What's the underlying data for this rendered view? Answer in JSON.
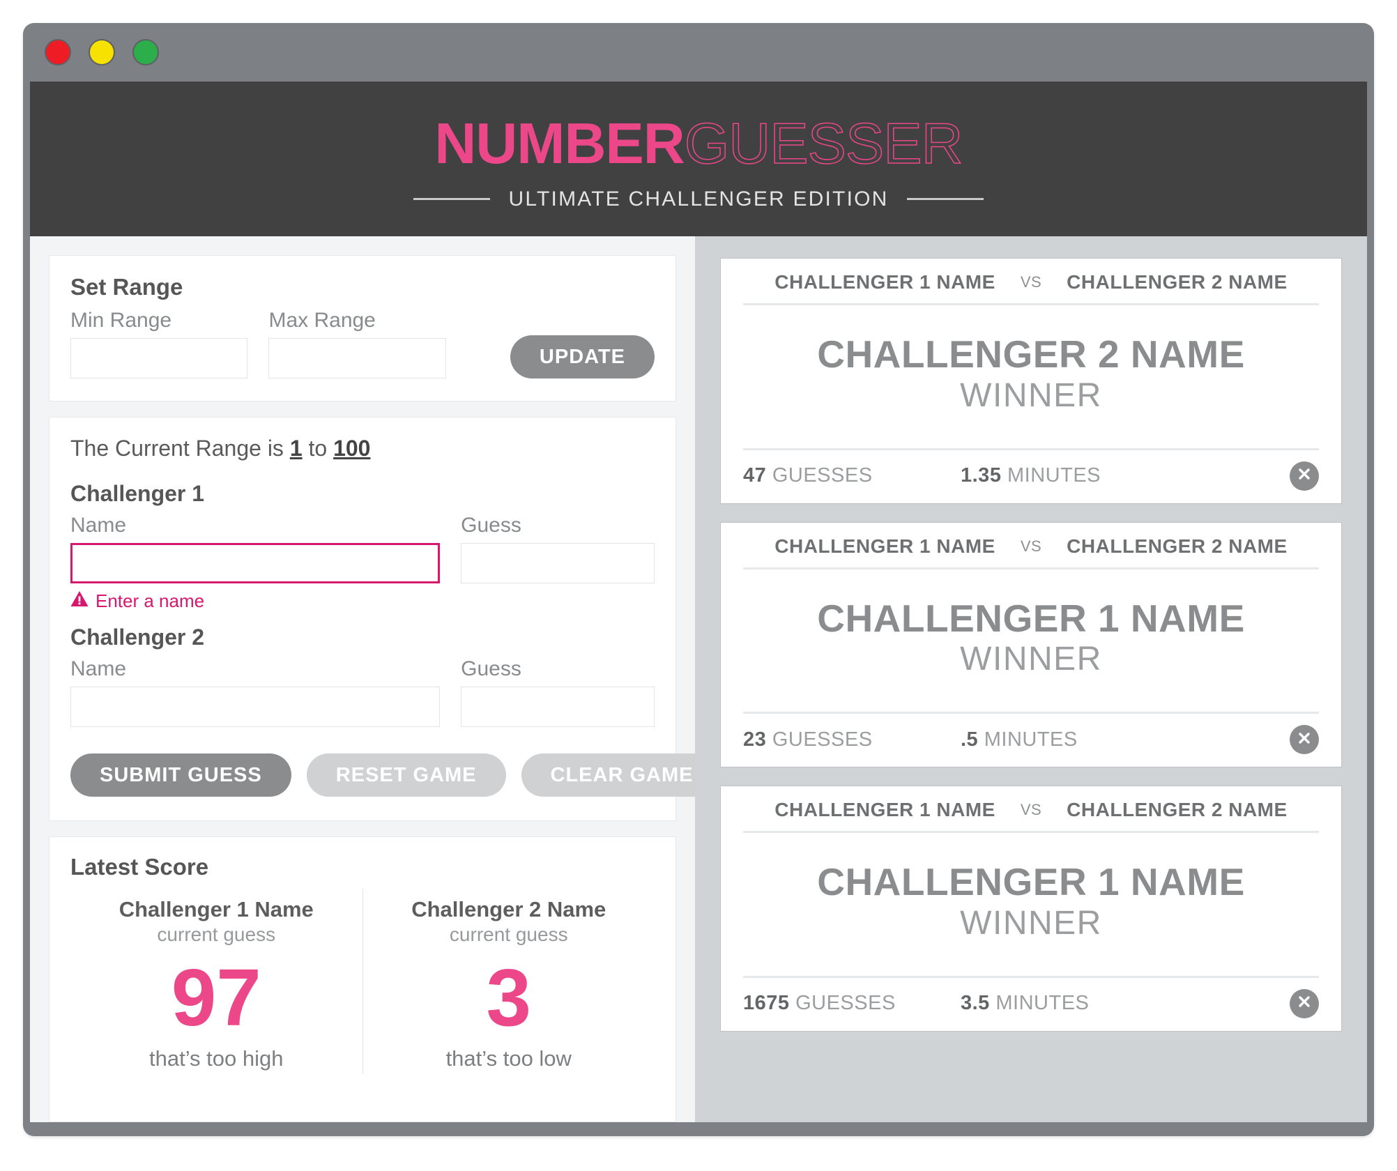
{
  "window": {
    "traffic_lights": [
      {
        "name": "close",
        "color": "#ee1d25"
      },
      {
        "name": "minimize",
        "color": "#f6e100"
      },
      {
        "name": "maximize",
        "color": "#2cae4a"
      }
    ]
  },
  "header": {
    "logo_bold": "NUMBER",
    "logo_light": "GUESSER",
    "subtitle": "ULTIMATE CHALLENGER EDITION",
    "accent_color": "#ec4889",
    "background": "#414141"
  },
  "set_range": {
    "title": "Set Range",
    "min_label": "Min Range",
    "min_value": "",
    "min_placeholder": "",
    "max_label": "Max Range",
    "max_value": "",
    "max_placeholder": "",
    "update_label": "UPDATE"
  },
  "game_form": {
    "range_prefix": "The Current Range is ",
    "range_min": "1",
    "range_joiner": " to ",
    "range_max": "100",
    "challenger_1": {
      "heading": "Challenger 1",
      "name_label": "Name",
      "name_value": "",
      "name_placeholder": "",
      "guess_label": "Guess",
      "guess_value": "",
      "guess_placeholder": "",
      "error": "Enter a name",
      "error_color": "#d8176f"
    },
    "challenger_2": {
      "heading": "Challenger 2",
      "name_label": "Name",
      "name_value": "",
      "name_placeholder": "",
      "guess_label": "Guess",
      "guess_value": "",
      "guess_placeholder": ""
    },
    "buttons": {
      "submit": "SUBMIT GUESS",
      "reset": "RESET GAME",
      "clear": "CLEAR GAME"
    }
  },
  "latest_score": {
    "title": "Latest Score",
    "players": [
      {
        "name": "Challenger 1 Name",
        "sub": "current guess",
        "value": "97",
        "hint": "that’s too high"
      },
      {
        "name": "Challenger 2 Name",
        "sub": "current guess",
        "value": "3",
        "hint": "that’s too low"
      }
    ]
  },
  "game_cards": [
    {
      "player_1": "CHALLENGER 1 NAME",
      "vs": "VS",
      "player_2": "CHALLENGER 2 NAME",
      "winner_name": "CHALLENGER 2 NAME",
      "winner_label": "WINNER",
      "guesses_value": "47",
      "guesses_label": " GUESSES",
      "minutes_value": "1.35",
      "minutes_label": " MINUTES"
    },
    {
      "player_1": "CHALLENGER 1 NAME",
      "vs": "VS",
      "player_2": "CHALLENGER 2 NAME",
      "winner_name": "CHALLENGER 1 NAME",
      "winner_label": "WINNER",
      "guesses_value": "23",
      "guesses_label": " GUESSES",
      "minutes_value": ".5",
      "minutes_label": " MINUTES"
    },
    {
      "player_1": "CHALLENGER 1 NAME",
      "vs": "VS",
      "player_2": "CHALLENGER 2 NAME",
      "winner_name": "CHALLENGER 1 NAME",
      "winner_label": "WINNER",
      "guesses_value": "1675",
      "guesses_label": " GUESSES",
      "minutes_value": "3.5",
      "minutes_label": " MINUTES"
    }
  ]
}
